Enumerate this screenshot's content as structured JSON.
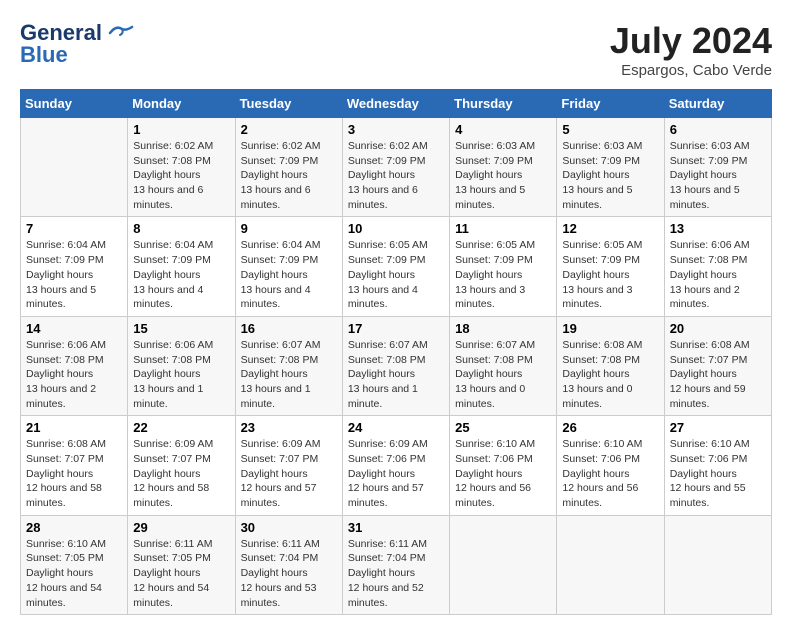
{
  "header": {
    "logo_general": "General",
    "logo_blue": "Blue",
    "month_year": "July 2024",
    "location": "Espargos, Cabo Verde"
  },
  "days_of_week": [
    "Sunday",
    "Monday",
    "Tuesday",
    "Wednesday",
    "Thursday",
    "Friday",
    "Saturday"
  ],
  "weeks": [
    [
      {
        "day": "",
        "sunrise": "",
        "sunset": "",
        "daylight": ""
      },
      {
        "day": "1",
        "sunrise": "6:02 AM",
        "sunset": "7:08 PM",
        "daylight": "13 hours and 6 minutes."
      },
      {
        "day": "2",
        "sunrise": "6:02 AM",
        "sunset": "7:09 PM",
        "daylight": "13 hours and 6 minutes."
      },
      {
        "day": "3",
        "sunrise": "6:02 AM",
        "sunset": "7:09 PM",
        "daylight": "13 hours and 6 minutes."
      },
      {
        "day": "4",
        "sunrise": "6:03 AM",
        "sunset": "7:09 PM",
        "daylight": "13 hours and 5 minutes."
      },
      {
        "day": "5",
        "sunrise": "6:03 AM",
        "sunset": "7:09 PM",
        "daylight": "13 hours and 5 minutes."
      },
      {
        "day": "6",
        "sunrise": "6:03 AM",
        "sunset": "7:09 PM",
        "daylight": "13 hours and 5 minutes."
      }
    ],
    [
      {
        "day": "7",
        "sunrise": "6:04 AM",
        "sunset": "7:09 PM",
        "daylight": "13 hours and 5 minutes."
      },
      {
        "day": "8",
        "sunrise": "6:04 AM",
        "sunset": "7:09 PM",
        "daylight": "13 hours and 4 minutes."
      },
      {
        "day": "9",
        "sunrise": "6:04 AM",
        "sunset": "7:09 PM",
        "daylight": "13 hours and 4 minutes."
      },
      {
        "day": "10",
        "sunrise": "6:05 AM",
        "sunset": "7:09 PM",
        "daylight": "13 hours and 4 minutes."
      },
      {
        "day": "11",
        "sunrise": "6:05 AM",
        "sunset": "7:09 PM",
        "daylight": "13 hours and 3 minutes."
      },
      {
        "day": "12",
        "sunrise": "6:05 AM",
        "sunset": "7:09 PM",
        "daylight": "13 hours and 3 minutes."
      },
      {
        "day": "13",
        "sunrise": "6:06 AM",
        "sunset": "7:08 PM",
        "daylight": "13 hours and 2 minutes."
      }
    ],
    [
      {
        "day": "14",
        "sunrise": "6:06 AM",
        "sunset": "7:08 PM",
        "daylight": "13 hours and 2 minutes."
      },
      {
        "day": "15",
        "sunrise": "6:06 AM",
        "sunset": "7:08 PM",
        "daylight": "13 hours and 1 minute."
      },
      {
        "day": "16",
        "sunrise": "6:07 AM",
        "sunset": "7:08 PM",
        "daylight": "13 hours and 1 minute."
      },
      {
        "day": "17",
        "sunrise": "6:07 AM",
        "sunset": "7:08 PM",
        "daylight": "13 hours and 1 minute."
      },
      {
        "day": "18",
        "sunrise": "6:07 AM",
        "sunset": "7:08 PM",
        "daylight": "13 hours and 0 minutes."
      },
      {
        "day": "19",
        "sunrise": "6:08 AM",
        "sunset": "7:08 PM",
        "daylight": "13 hours and 0 minutes."
      },
      {
        "day": "20",
        "sunrise": "6:08 AM",
        "sunset": "7:07 PM",
        "daylight": "12 hours and 59 minutes."
      }
    ],
    [
      {
        "day": "21",
        "sunrise": "6:08 AM",
        "sunset": "7:07 PM",
        "daylight": "12 hours and 58 minutes."
      },
      {
        "day": "22",
        "sunrise": "6:09 AM",
        "sunset": "7:07 PM",
        "daylight": "12 hours and 58 minutes."
      },
      {
        "day": "23",
        "sunrise": "6:09 AM",
        "sunset": "7:07 PM",
        "daylight": "12 hours and 57 minutes."
      },
      {
        "day": "24",
        "sunrise": "6:09 AM",
        "sunset": "7:06 PM",
        "daylight": "12 hours and 57 minutes."
      },
      {
        "day": "25",
        "sunrise": "6:10 AM",
        "sunset": "7:06 PM",
        "daylight": "12 hours and 56 minutes."
      },
      {
        "day": "26",
        "sunrise": "6:10 AM",
        "sunset": "7:06 PM",
        "daylight": "12 hours and 56 minutes."
      },
      {
        "day": "27",
        "sunrise": "6:10 AM",
        "sunset": "7:06 PM",
        "daylight": "12 hours and 55 minutes."
      }
    ],
    [
      {
        "day": "28",
        "sunrise": "6:10 AM",
        "sunset": "7:05 PM",
        "daylight": "12 hours and 54 minutes."
      },
      {
        "day": "29",
        "sunrise": "6:11 AM",
        "sunset": "7:05 PM",
        "daylight": "12 hours and 54 minutes."
      },
      {
        "day": "30",
        "sunrise": "6:11 AM",
        "sunset": "7:04 PM",
        "daylight": "12 hours and 53 minutes."
      },
      {
        "day": "31",
        "sunrise": "6:11 AM",
        "sunset": "7:04 PM",
        "daylight": "12 hours and 52 minutes."
      },
      {
        "day": "",
        "sunrise": "",
        "sunset": "",
        "daylight": ""
      },
      {
        "day": "",
        "sunrise": "",
        "sunset": "",
        "daylight": ""
      },
      {
        "day": "",
        "sunrise": "",
        "sunset": "",
        "daylight": ""
      }
    ]
  ]
}
